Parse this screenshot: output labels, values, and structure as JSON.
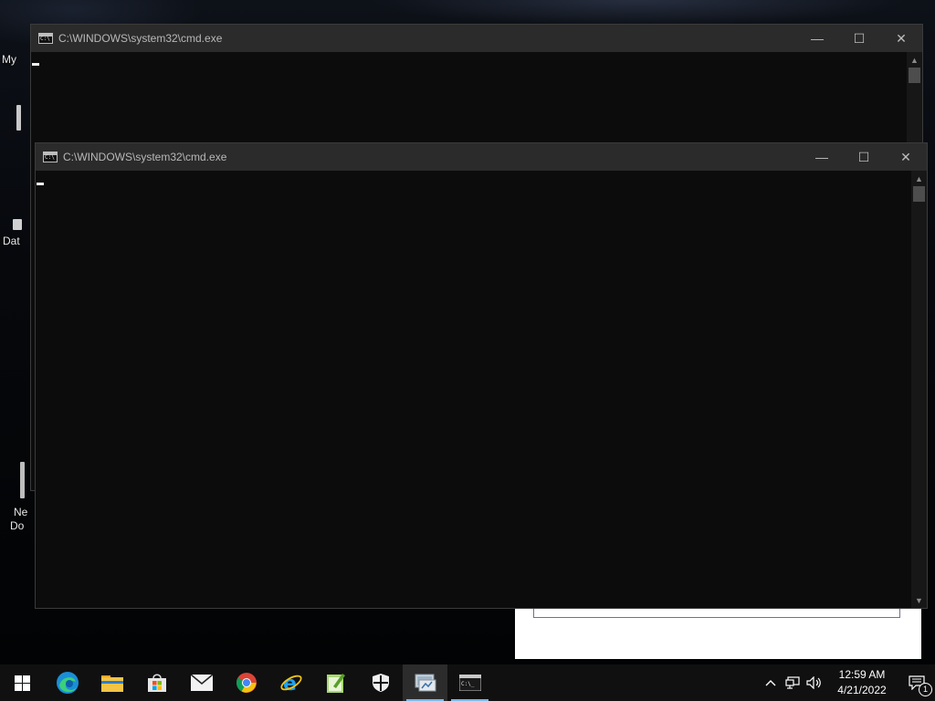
{
  "desktop": {
    "icons": [
      {
        "label": "My"
      },
      {
        "label": "Dat"
      },
      {
        "label": "Ne"
      },
      {
        "label": "Do"
      }
    ]
  },
  "windows": {
    "back": {
      "title": "C:\\WINDOWS\\system32\\cmd.exe",
      "minimize": "—",
      "maximize": "☐",
      "close": "✕"
    },
    "front": {
      "title": "C:\\WINDOWS\\system32\\cmd.exe",
      "minimize": "—",
      "maximize": "☐",
      "close": "✕"
    }
  },
  "taskbar": {
    "apps": [
      {
        "name": "start-icon"
      },
      {
        "name": "edge-icon"
      },
      {
        "name": "file-explorer-icon"
      },
      {
        "name": "store-icon"
      },
      {
        "name": "mail-icon"
      },
      {
        "name": "chrome-icon"
      },
      {
        "name": "internet-explorer-icon"
      },
      {
        "name": "notepad-plus-icon"
      },
      {
        "name": "security-shield-icon"
      },
      {
        "name": "remote-desktop-icon"
      },
      {
        "name": "cmd-icon"
      }
    ],
    "clock": {
      "time": "12:59 AM",
      "date": "4/21/2022"
    },
    "notification_count": "1",
    "accent": "#76b9ed"
  }
}
